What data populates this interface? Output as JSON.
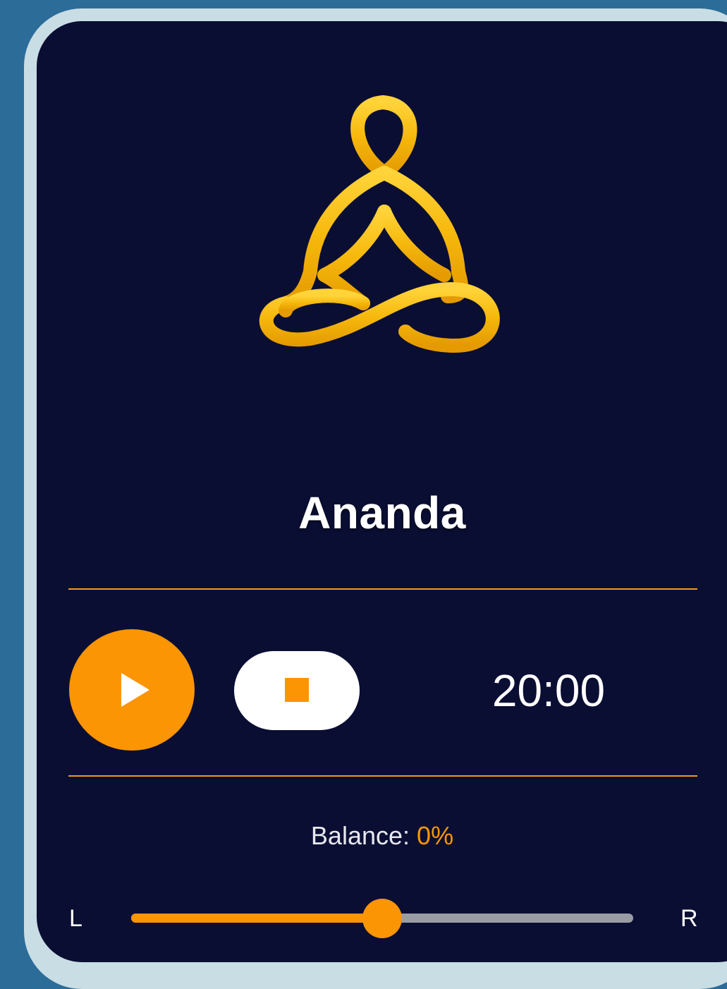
{
  "app": {
    "title": "Ananda",
    "logo_icon": "meditation-pose-icon"
  },
  "controls": {
    "play_icon": "play-icon",
    "stop_icon": "stop-icon",
    "timer": "20:00"
  },
  "balance": {
    "label": "Balance:",
    "value": "0%",
    "left_label": "L",
    "right_label": "R",
    "position_fraction": 0.5
  },
  "colors": {
    "accent": "#fb9504",
    "background": "#0a0e33",
    "frame": "#c9dde4",
    "page": "#2c6c99"
  }
}
